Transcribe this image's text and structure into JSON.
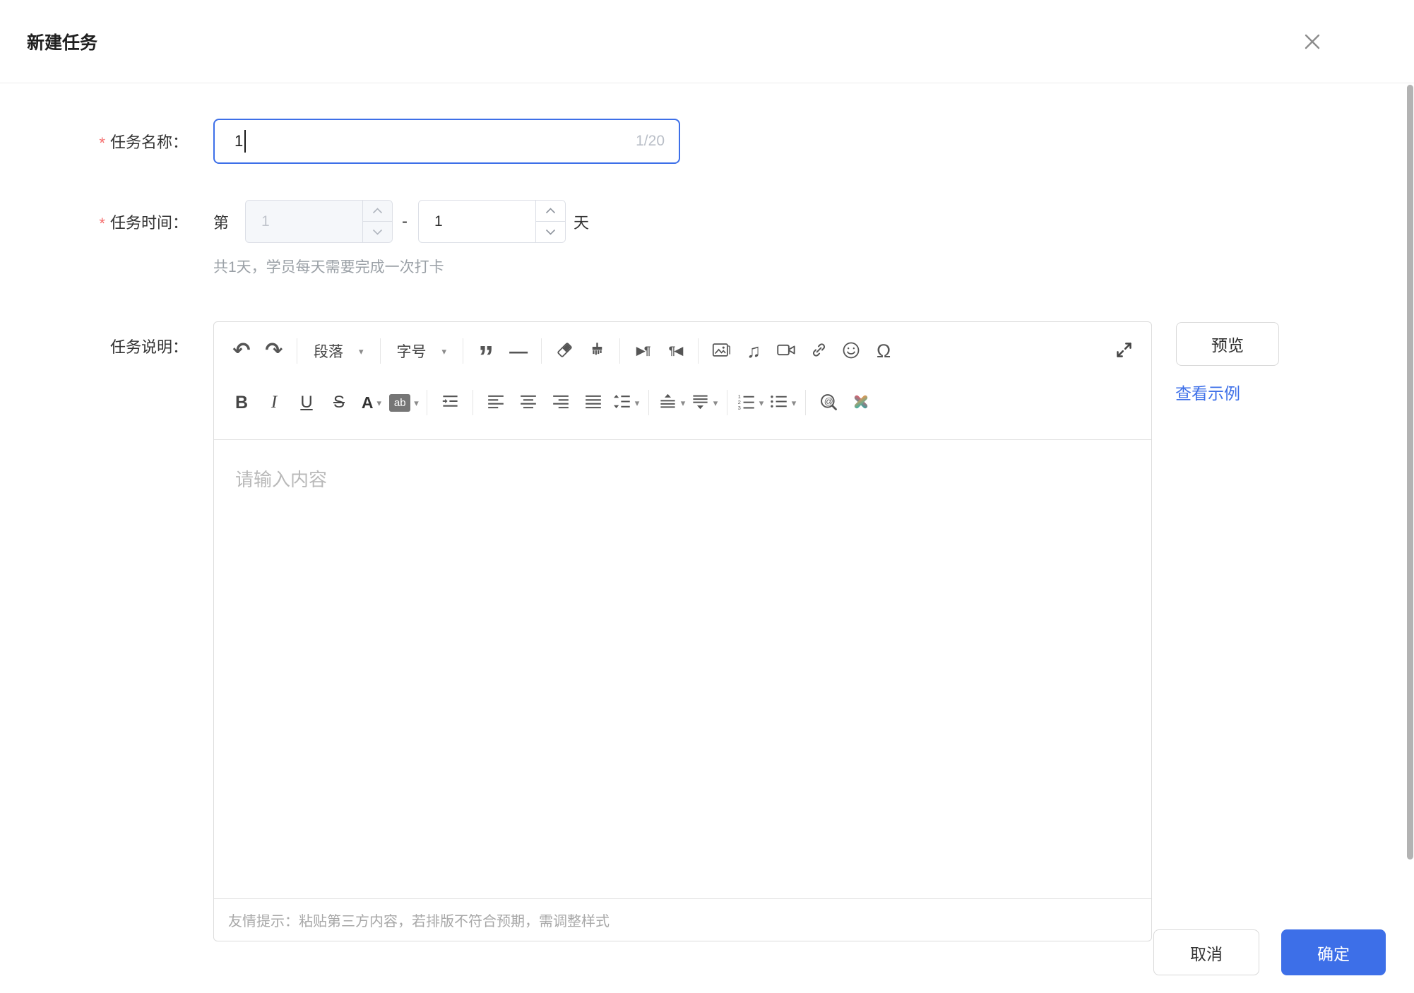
{
  "dialog": {
    "title": "新建任务"
  },
  "form": {
    "task_name": {
      "required_mark": "*",
      "label": "任务名称：",
      "value": "1",
      "counter": "1/20"
    },
    "task_time": {
      "required_mark": "*",
      "label": "任务时间：",
      "prefix": "第",
      "start_value": "1",
      "range_separator": "-",
      "end_value": "1",
      "suffix": "天",
      "helper": "共1天，学员每天需要完成一次打卡"
    },
    "task_desc": {
      "label": "任务说明：",
      "placeholder": "请输入内容",
      "paste_hint": "友情提示：粘贴第三方内容，若排版不符合预期，需调整样式"
    }
  },
  "editor_toolbar": {
    "paragraph_label": "段落",
    "font_size_label": "字号"
  },
  "icons": {
    "undo": "↶",
    "redo": "↷",
    "dropdown_caret": "▾",
    "blockquote": "”",
    "horizontal_rule": "—",
    "indent_paragraph": "▶¶",
    "outdent_paragraph": "¶◀",
    "music_note": "♫",
    "omega": "Ω",
    "bold": "B",
    "italic": "I",
    "underline": "U",
    "strikethrough": "S",
    "font_color": "A",
    "highlight": "ab"
  },
  "side_actions": {
    "preview_button": "预览",
    "example_link": "查看示例"
  },
  "footer": {
    "cancel_button": "取消",
    "confirm_button": "确定"
  },
  "colors": {
    "primary": "#3D6FE8",
    "danger": "#F56C6C",
    "link_blue": "#3D6FE8",
    "disabled_bg": "#F5F7FA",
    "border_gray": "#DCDFE6"
  }
}
